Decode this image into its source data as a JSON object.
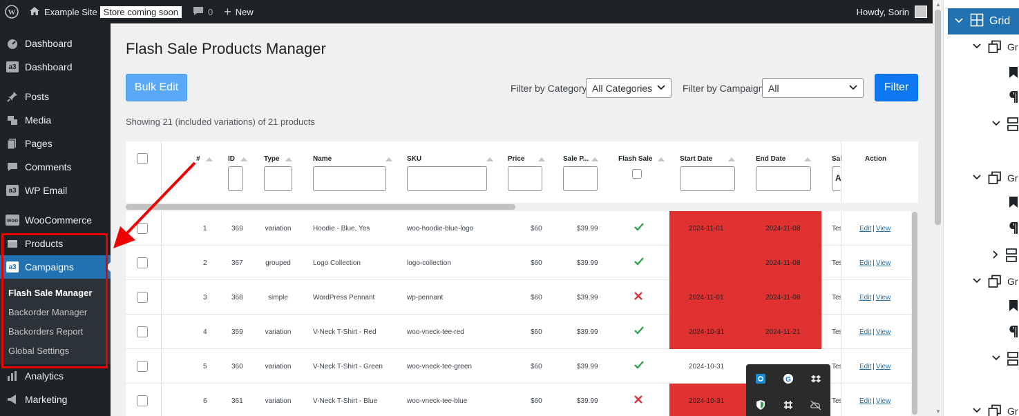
{
  "adminbar": {
    "site_name": "Example Site",
    "store_badge": "Store coming soon",
    "comments_count": "0",
    "new_label": "New",
    "howdy": "Howdy, Sorin"
  },
  "sidebar": {
    "items": [
      {
        "label": "Dashboard",
        "icon": "dashboard-icon"
      },
      {
        "label": "Dashboard",
        "icon": "a3-icon"
      },
      {
        "label": "Posts",
        "icon": "pin-icon"
      },
      {
        "label": "Media",
        "icon": "media-icon"
      },
      {
        "label": "Pages",
        "icon": "pages-icon"
      },
      {
        "label": "Comments",
        "icon": "comment-icon"
      },
      {
        "label": "WP Email",
        "icon": "a3-icon"
      },
      {
        "label": "WooCommerce",
        "icon": "woo-icon"
      },
      {
        "label": "Products",
        "icon": "products-icon"
      },
      {
        "label": "Campaigns",
        "icon": "a3-icon"
      },
      {
        "label": "Analytics",
        "icon": "analytics-icon"
      },
      {
        "label": "Marketing",
        "icon": "marketing-icon"
      }
    ],
    "submenu": [
      "Flash Sale Manager",
      "Backorder Manager",
      "Backorders Report",
      "Global Settings"
    ]
  },
  "main": {
    "title": "Flash Sale Products Manager",
    "bulk_edit": "Bulk Edit",
    "filter_category_label": "Filter by Category:",
    "filter_category_value": "All Categories",
    "filter_campaign_label": "Filter by Campaign:",
    "filter_campaign_value": "All",
    "filter_button": "Filter",
    "showing": "Showing 21 (included variations) of 21 products"
  },
  "table": {
    "columns": [
      "#",
      "ID",
      "Type",
      "Name",
      "SKU",
      "Price",
      "Sale P...",
      "Flash Sale",
      "Start Date",
      "End Date",
      "Sal",
      "Action"
    ],
    "rows": [
      {
        "num": "1",
        "id": "369",
        "type": "variation",
        "name": "Hoodie - Blue, Yes",
        "sku": "woo-hoodie-blue-logo",
        "price": "$60",
        "sale": "$39.99",
        "flash": "yes",
        "start": "2024-11-01",
        "end": "2024-11-08",
        "sal": "Tes",
        "red": true
      },
      {
        "num": "2",
        "id": "367",
        "type": "grouped",
        "name": "Logo Collection",
        "sku": "logo-collection",
        "price": "$60",
        "sale": "$39.99",
        "flash": "yes",
        "start": "",
        "end": "2024-11-08",
        "sal": "Tes",
        "red": true
      },
      {
        "num": "3",
        "id": "368",
        "type": "simple",
        "name": "WordPress Pennant",
        "sku": "wp-pennant",
        "price": "$60",
        "sale": "$39.99",
        "flash": "no",
        "start": "2024-11-01",
        "end": "2024-11-08",
        "sal": "Tes",
        "red": true
      },
      {
        "num": "4",
        "id": "359",
        "type": "variation",
        "name": "V-Neck T-Shirt - Red",
        "sku": "woo-vneck-tee-red",
        "price": "$60",
        "sale": "$39.99",
        "flash": "yes",
        "start": "2024-10-31",
        "end": "2024-11-21",
        "sal": "Tes",
        "red": true
      },
      {
        "num": "5",
        "id": "360",
        "type": "variation",
        "name": "V-Neck T-Shirt - Green",
        "sku": "woo-vneck-tee-green",
        "price": "$60",
        "sale": "$39.99",
        "flash": "yes",
        "start": "2024-10-31",
        "end": "",
        "sal": "Tes",
        "red": false
      },
      {
        "num": "6",
        "id": "361",
        "type": "variation",
        "name": "V-Neck T-Shirt - Blue",
        "sku": "woo-vneck-tee-blue",
        "price": "$60",
        "sale": "$39.99",
        "flash": "no",
        "start": "2024-10-31",
        "end": "",
        "sal": "Tes",
        "red": true
      }
    ],
    "edit_label": "Edit",
    "view_label": "View"
  },
  "rpanel": {
    "head": "Grid",
    "item_label": "Gr"
  },
  "colors": {
    "admin_dark": "#1d2327",
    "accent_blue": "#2271b1",
    "red_highlight": "#e03131",
    "annotation_red": "#e00000"
  }
}
